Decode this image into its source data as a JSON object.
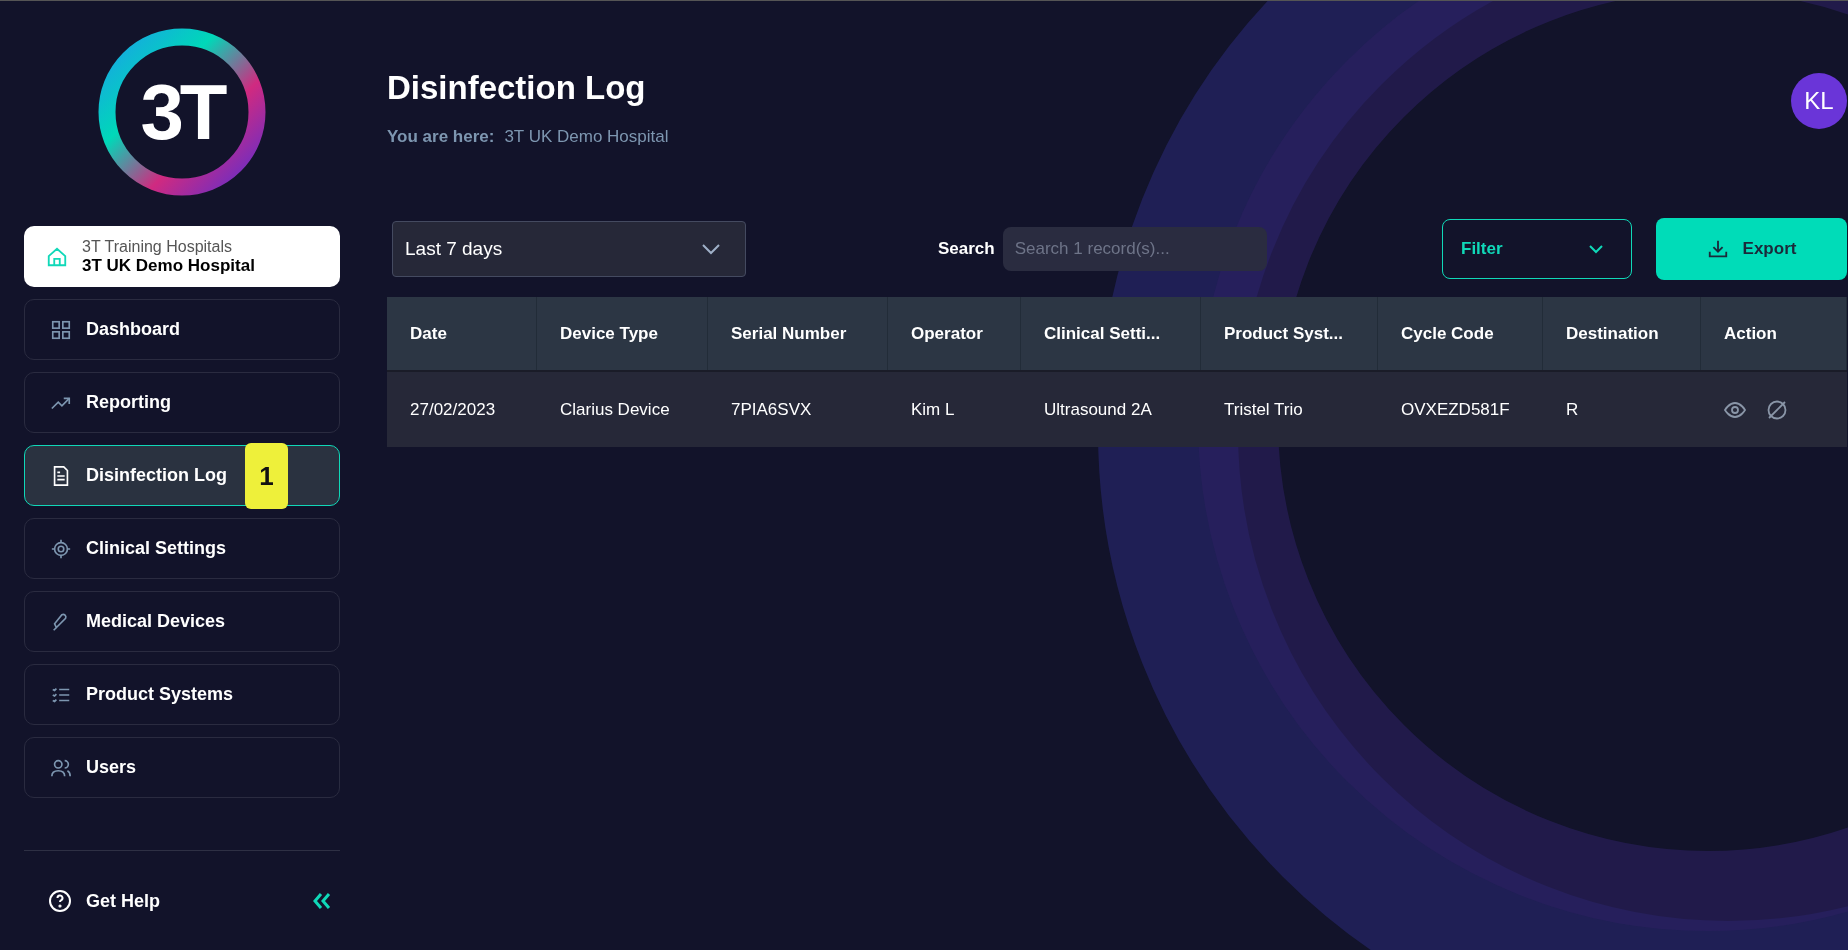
{
  "sidebar": {
    "logo_text": "3T",
    "hospital": {
      "group": "3T Training Hospitals",
      "name": "3T UK Demo Hospital"
    },
    "items": [
      {
        "label": "Dashboard",
        "selected": false
      },
      {
        "label": "Reporting",
        "selected": false
      },
      {
        "label": "Disinfection Log",
        "selected": true,
        "annotation_badge": "1"
      },
      {
        "label": "Clinical Settings",
        "selected": false
      },
      {
        "label": "Medical Devices",
        "selected": false
      },
      {
        "label": "Product Systems",
        "selected": false
      },
      {
        "label": "Users",
        "selected": false
      }
    ],
    "help": "Get Help"
  },
  "header": {
    "title": "Disinfection Log",
    "breadcrumb_label": "You are here:",
    "breadcrumb_value": "3T UK Demo Hospital",
    "avatar": "KL"
  },
  "toolbar": {
    "date_range": "Last 7 days",
    "search_label": "Search",
    "search": {
      "placeholder": "Search 1 record(s)..."
    },
    "filter": "Filter",
    "export": "Export"
  },
  "table": {
    "columns": [
      "Date",
      "Device Type",
      "Serial Number",
      "Operator",
      "Clinical Setti...",
      "Product Syst...",
      "Cycle Code",
      "Destination",
      "Action"
    ],
    "rows": [
      [
        "27/02/2023",
        "Clarius Device",
        "7PIA6SVX",
        "Kim L",
        "Ultrasound 2A",
        "Tristel Trio",
        "OVXEZD581F",
        "R"
      ]
    ]
  }
}
